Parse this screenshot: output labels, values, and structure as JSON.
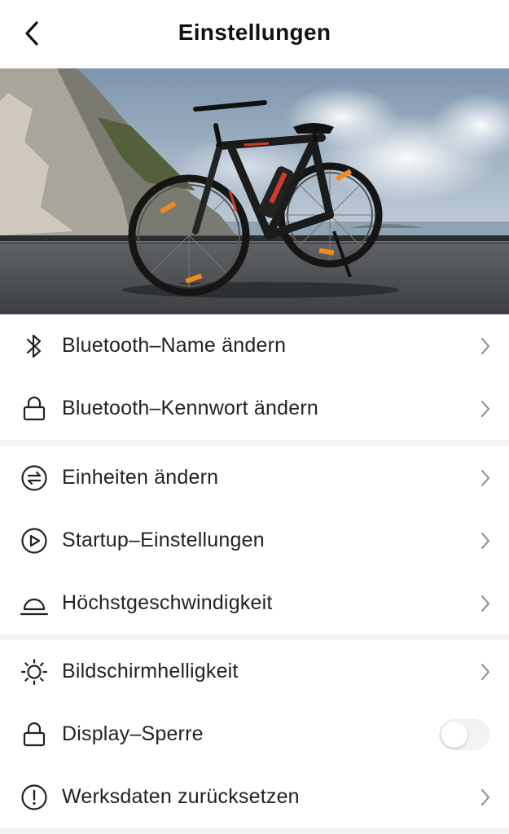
{
  "header": {
    "title": "Einstellungen",
    "back_icon": "chevron-left-icon"
  },
  "hero": {
    "image": "e-bike on a coastal road"
  },
  "groups": [
    {
      "items": [
        {
          "label": "Bluetooth–Name ändern",
          "icon": "bluetooth-icon",
          "control": "chevron"
        },
        {
          "label": "Bluetooth–Kennwort ändern",
          "icon": "lock-icon",
          "control": "chevron"
        }
      ]
    },
    {
      "items": [
        {
          "label": "Einheiten ändern",
          "icon": "swap-units-icon",
          "control": "chevron"
        },
        {
          "label": "Startup–Einstellungen",
          "icon": "play-circle-icon",
          "control": "chevron"
        },
        {
          "label": "Höchstgeschwindigkeit",
          "icon": "speed-dome-icon",
          "control": "chevron"
        }
      ]
    },
    {
      "items": [
        {
          "label": "Bildschirmhelligkeit",
          "icon": "brightness-icon",
          "control": "chevron"
        },
        {
          "label": "Display–Sperre",
          "icon": "lock-icon",
          "control": "toggle",
          "toggle_on": false
        },
        {
          "label": "Werksdaten zurücksetzen",
          "icon": "warning-circle-icon",
          "control": "chevron"
        }
      ]
    }
  ],
  "colors": {
    "background": "#f4f4f4",
    "card": "#ffffff",
    "text": "#222222",
    "chevron": "#8a8a8a",
    "toggle_off": "#f3f3f3"
  }
}
